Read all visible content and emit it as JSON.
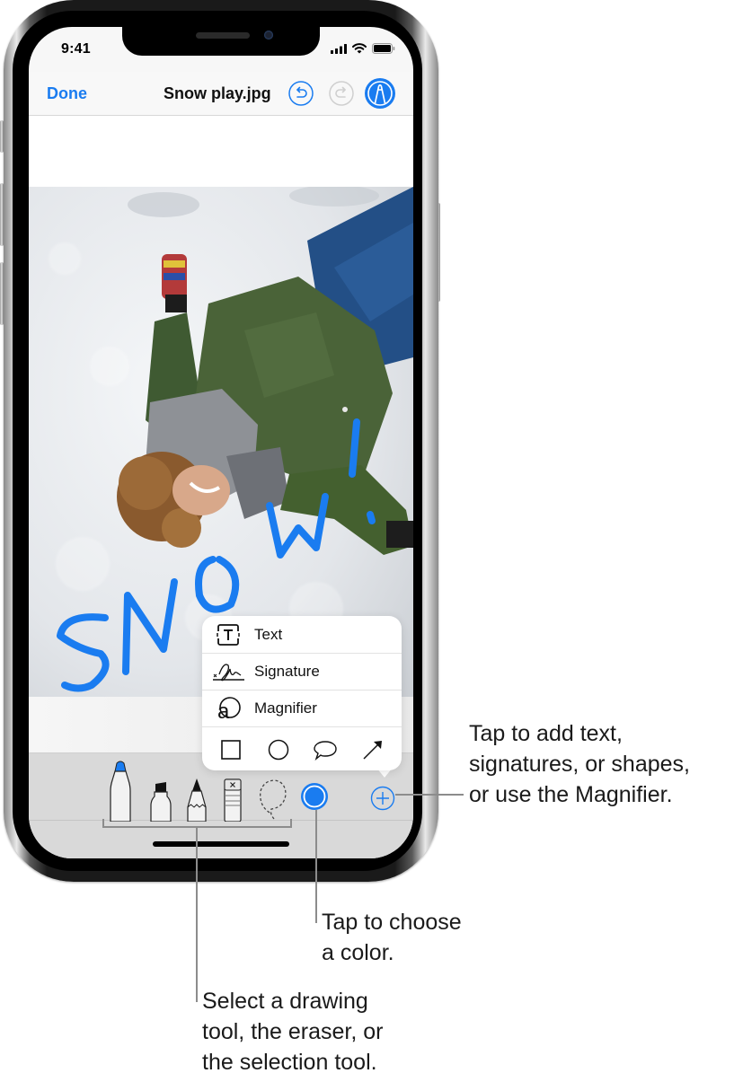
{
  "status_bar": {
    "time": "9:41",
    "icons": [
      "cellular-signal-icon",
      "wifi-icon",
      "battery-icon"
    ]
  },
  "navbar": {
    "done_label": "Done",
    "title": "Snow play.jpg",
    "buttons": [
      "undo-icon",
      "redo-icon",
      "markup-icon"
    ],
    "redo_enabled": false,
    "markup_active": true
  },
  "canvas": {
    "image_description": "Child lying in snow making a snow angel, wearing green jacket and blue snow pants",
    "annotation_text": "SNOW!",
    "annotation_color": "#1a7cf0"
  },
  "popover_menu": {
    "items": [
      {
        "label": "Text",
        "icon": "text-box-icon"
      },
      {
        "label": "Signature",
        "icon": "signature-icon"
      },
      {
        "label": "Magnifier",
        "icon": "magnifier-icon"
      }
    ],
    "shapes": [
      "square-icon",
      "circle-icon",
      "speech-bubble-icon",
      "arrow-icon"
    ]
  },
  "toolbar": {
    "tools": [
      "pen-tool",
      "marker-tool",
      "pencil-tool",
      "eraser-tool",
      "lasso-tool"
    ],
    "selected_tool": "pen-tool",
    "current_color": "#1a7cf0",
    "add_button": "plus-icon"
  },
  "callouts": {
    "add": "Tap to add text,\nsignatures, or shapes,\nor use the Magnifier.",
    "color": "Tap to choose\na color.",
    "tools": "Select a drawing\ntool, the eraser, or\nthe selection tool."
  },
  "colors": {
    "accent": "#1a7cf0",
    "text": "#111111",
    "toolbar_bg": "#d9d9d9"
  }
}
